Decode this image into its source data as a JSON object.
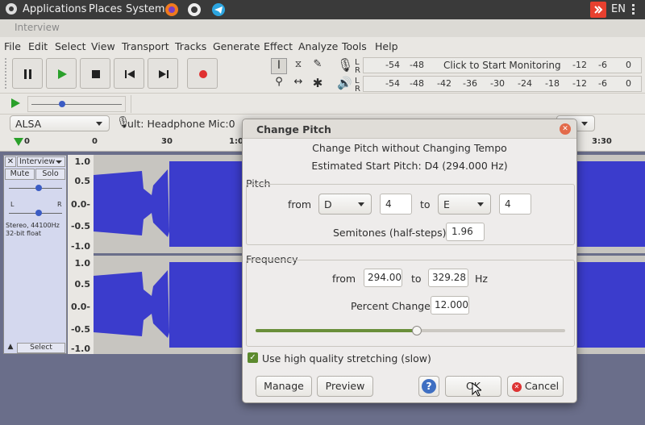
{
  "panel": {
    "applications": "Applications",
    "places": "Places",
    "system": "System",
    "lang": "EN"
  },
  "window": {
    "title": "Interview"
  },
  "menu": [
    "File",
    "Edit",
    "Select",
    "View",
    "Transport",
    "Tracks",
    "Generate",
    "Effect",
    "Analyze",
    "Tools",
    "Help"
  ],
  "meters": {
    "rec_label_l": "L",
    "rec_label_r": "R",
    "play_label_l": "L",
    "play_label_r": "R",
    "rec_ticks": [
      "-54",
      "-48"
    ],
    "rec_ticks2": [
      "-12",
      "-6",
      "0"
    ],
    "monitor": "Click to Start Monitoring",
    "play_ticks": [
      "-54",
      "-48",
      "-42",
      "-36",
      "-30",
      "-24",
      "-18",
      "-12",
      "-6",
      "0"
    ]
  },
  "device": {
    "host": "ALSA",
    "mic": "ult: Headphone Mic:0"
  },
  "timeline": [
    "0",
    "0",
    "30",
    "1:0",
    "3:30"
  ],
  "track": {
    "name": "Interview",
    "mute": "Mute",
    "solo": "Solo",
    "gain_l": "L",
    "gain_r": "R",
    "info1": "Stereo, 44100Hz",
    "info2": "32-bit float",
    "select": "Select",
    "ylabels": [
      "1.0",
      "0.5",
      "0.0-",
      "-0.5",
      "-1.0",
      "1.0",
      "0.5",
      "0.0-",
      "-0.5",
      "-1.0"
    ]
  },
  "dialog": {
    "title": "Change Pitch",
    "heading": "Change Pitch without Changing Tempo",
    "estimated": "Estimated Start Pitch: D4 (294.000 Hz)",
    "pitch_label": "Pitch",
    "from": "from",
    "to": "to",
    "from_note": "D",
    "from_octave": "4",
    "to_note": "E",
    "to_octave": "4",
    "semitones_label": "Semitones (half-steps):",
    "semitones": "1.96",
    "frequency_label": "Frequency",
    "freq_from": "294.00",
    "freq_to": "329.28",
    "hz": "Hz",
    "percent_label": "Percent Change:",
    "percent": "12.000",
    "slider_fraction": 0.52,
    "hq_label": "Use high quality stretching (slow)",
    "hq_checked": true,
    "manage": "Manage",
    "preview": "Preview",
    "help": "?",
    "ok": "OK",
    "cancel": "Cancel"
  },
  "colors": {
    "accent": "#3b3ccc",
    "play": "#2aa02a",
    "record": "#e03030",
    "check": "#5c8a2e"
  }
}
